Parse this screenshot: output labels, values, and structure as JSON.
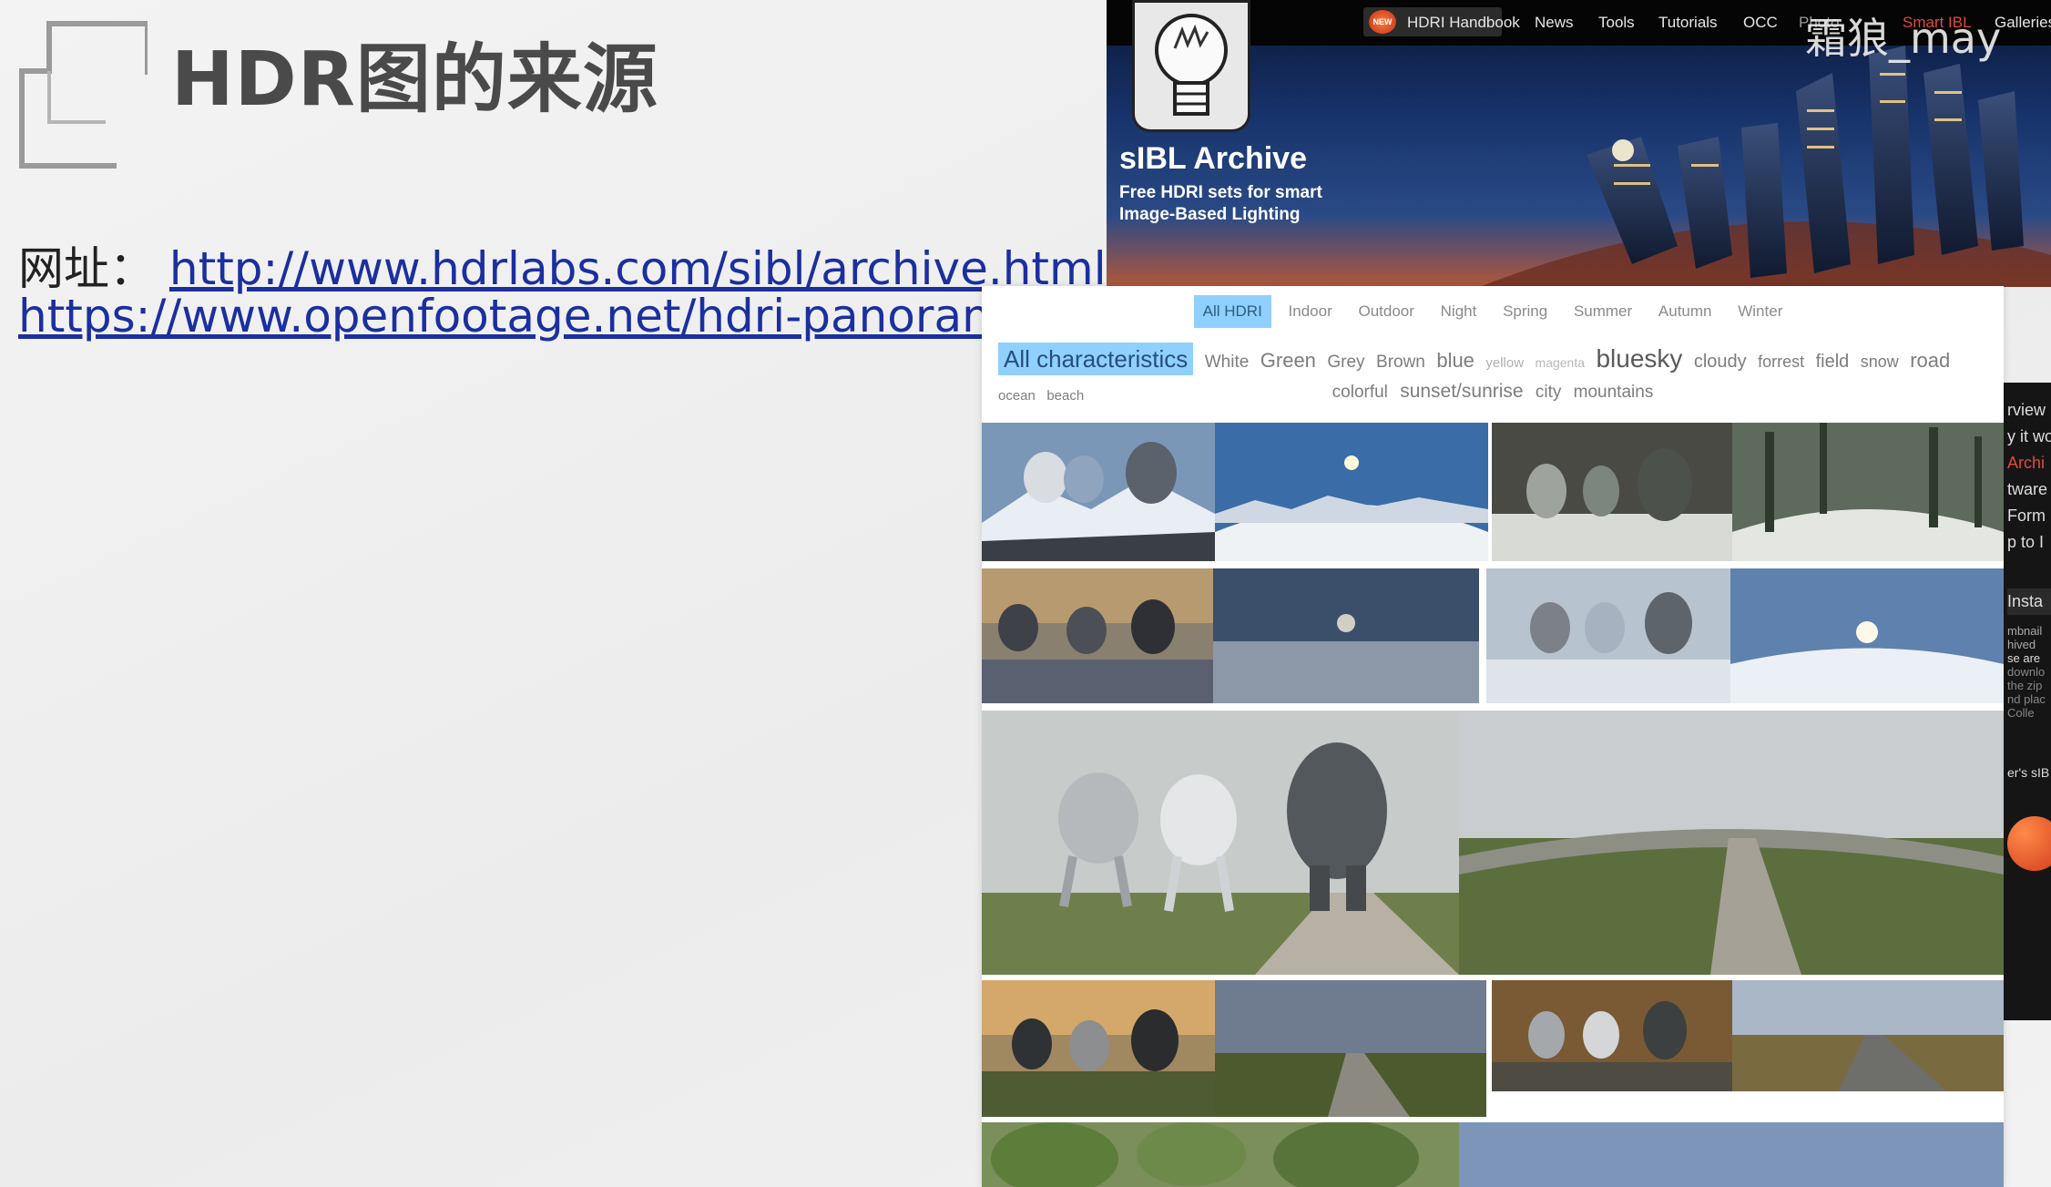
{
  "slide": {
    "title": "HDR图的来源",
    "url_label": "网址：",
    "url1": "http://www.hdrlabs.com/sibl/archive.html",
    "url2": "https://www.openfootage.net/hdri-panorama/"
  },
  "site": {
    "nav": {
      "handbook": "HDRI Handbook",
      "new_badge": "NEW",
      "items": [
        "News",
        "Tools",
        "Tutorials",
        "OCC",
        "Photo",
        "Smart IBL",
        "Galleries"
      ]
    },
    "brand": "sIBL Archive",
    "tagline_1": "Free HDRI sets for smart",
    "tagline_2": "Image-Based Lighting",
    "watermark": "霜狼_may"
  },
  "gallery": {
    "filters": [
      "All HDRI",
      "Indoor",
      "Outdoor",
      "Night",
      "Spring",
      "Summer",
      "Autumn",
      "Winter"
    ],
    "active_filter": "All HDRI",
    "characteristics": [
      {
        "label": "All characteristics",
        "active": true
      },
      {
        "label": "White"
      },
      {
        "label": "Green"
      },
      {
        "label": "Grey"
      },
      {
        "label": "Brown"
      },
      {
        "label": "blue"
      },
      {
        "label": "yellow"
      },
      {
        "label": "magenta"
      },
      {
        "label": "bluesky"
      },
      {
        "label": "cloudy"
      },
      {
        "label": "forrest"
      },
      {
        "label": "field"
      },
      {
        "label": "snow"
      },
      {
        "label": "road"
      },
      {
        "label": "ocean"
      },
      {
        "label": "beach"
      }
    ],
    "characteristics_row2": [
      "colorful",
      "sunset/sunrise",
      "city",
      "mountains"
    ]
  },
  "sidebar_fragments": [
    "rview",
    "y it wo",
    "Archi",
    "tware",
    "Form",
    "p to I",
    "Insta",
    "mbnail",
    "hived",
    "se are",
    "downlo",
    "the zip",
    "nd plac",
    "Colle",
    "er's sIB"
  ]
}
